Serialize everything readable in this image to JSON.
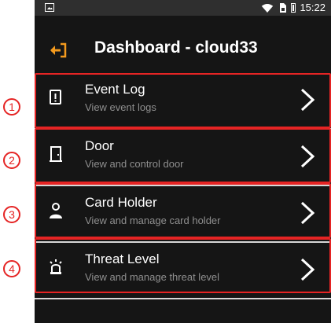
{
  "status": {
    "time": "15:22"
  },
  "header": {
    "title": "Dashboard - cloud33"
  },
  "menu": {
    "items": [
      {
        "title": "Event Log",
        "subtitle": "View event logs",
        "icon": "exclamation-icon"
      },
      {
        "title": "Door",
        "subtitle": "View and control door",
        "icon": "door-icon"
      },
      {
        "title": "Card Holder",
        "subtitle": "View and manage card holder",
        "icon": "person-icon"
      },
      {
        "title": "Threat Level",
        "subtitle": "View and manage threat level",
        "icon": "siren-icon"
      }
    ]
  },
  "annotations": [
    "1",
    "2",
    "3",
    "4"
  ],
  "colors": {
    "background": "#151515",
    "statusbar": "#2f2f2f",
    "accent": "#f39a1e",
    "annotation": "#e52424"
  }
}
